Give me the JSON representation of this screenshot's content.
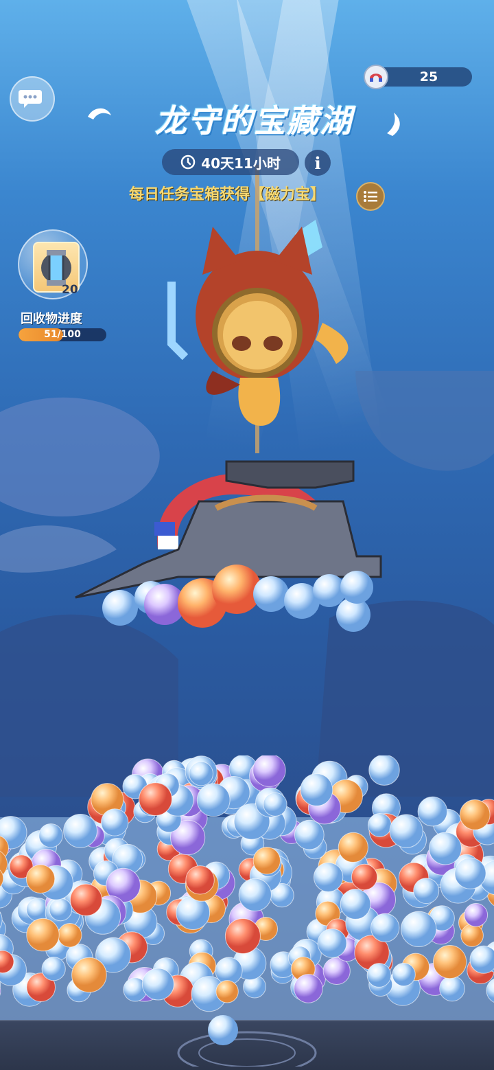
{
  "counter": {
    "value": "25",
    "icon": "magnet-icon"
  },
  "title": "龙守的宝藏湖",
  "timer": {
    "text": "40天11小时",
    "icon": "clock-icon"
  },
  "info": {
    "label": "i"
  },
  "task": {
    "text": "每日任务宝箱获得【磁力宝】"
  },
  "recycle": {
    "item_count": "20",
    "label": "回收物进度",
    "progress_text": "51/100",
    "progress_fraction": 0.51
  },
  "colors": {
    "water_top": "#5fb0ea",
    "water_bottom": "#2a3f70",
    "task_text": "#f5d872",
    "progress_fill": "#f6a33e"
  }
}
